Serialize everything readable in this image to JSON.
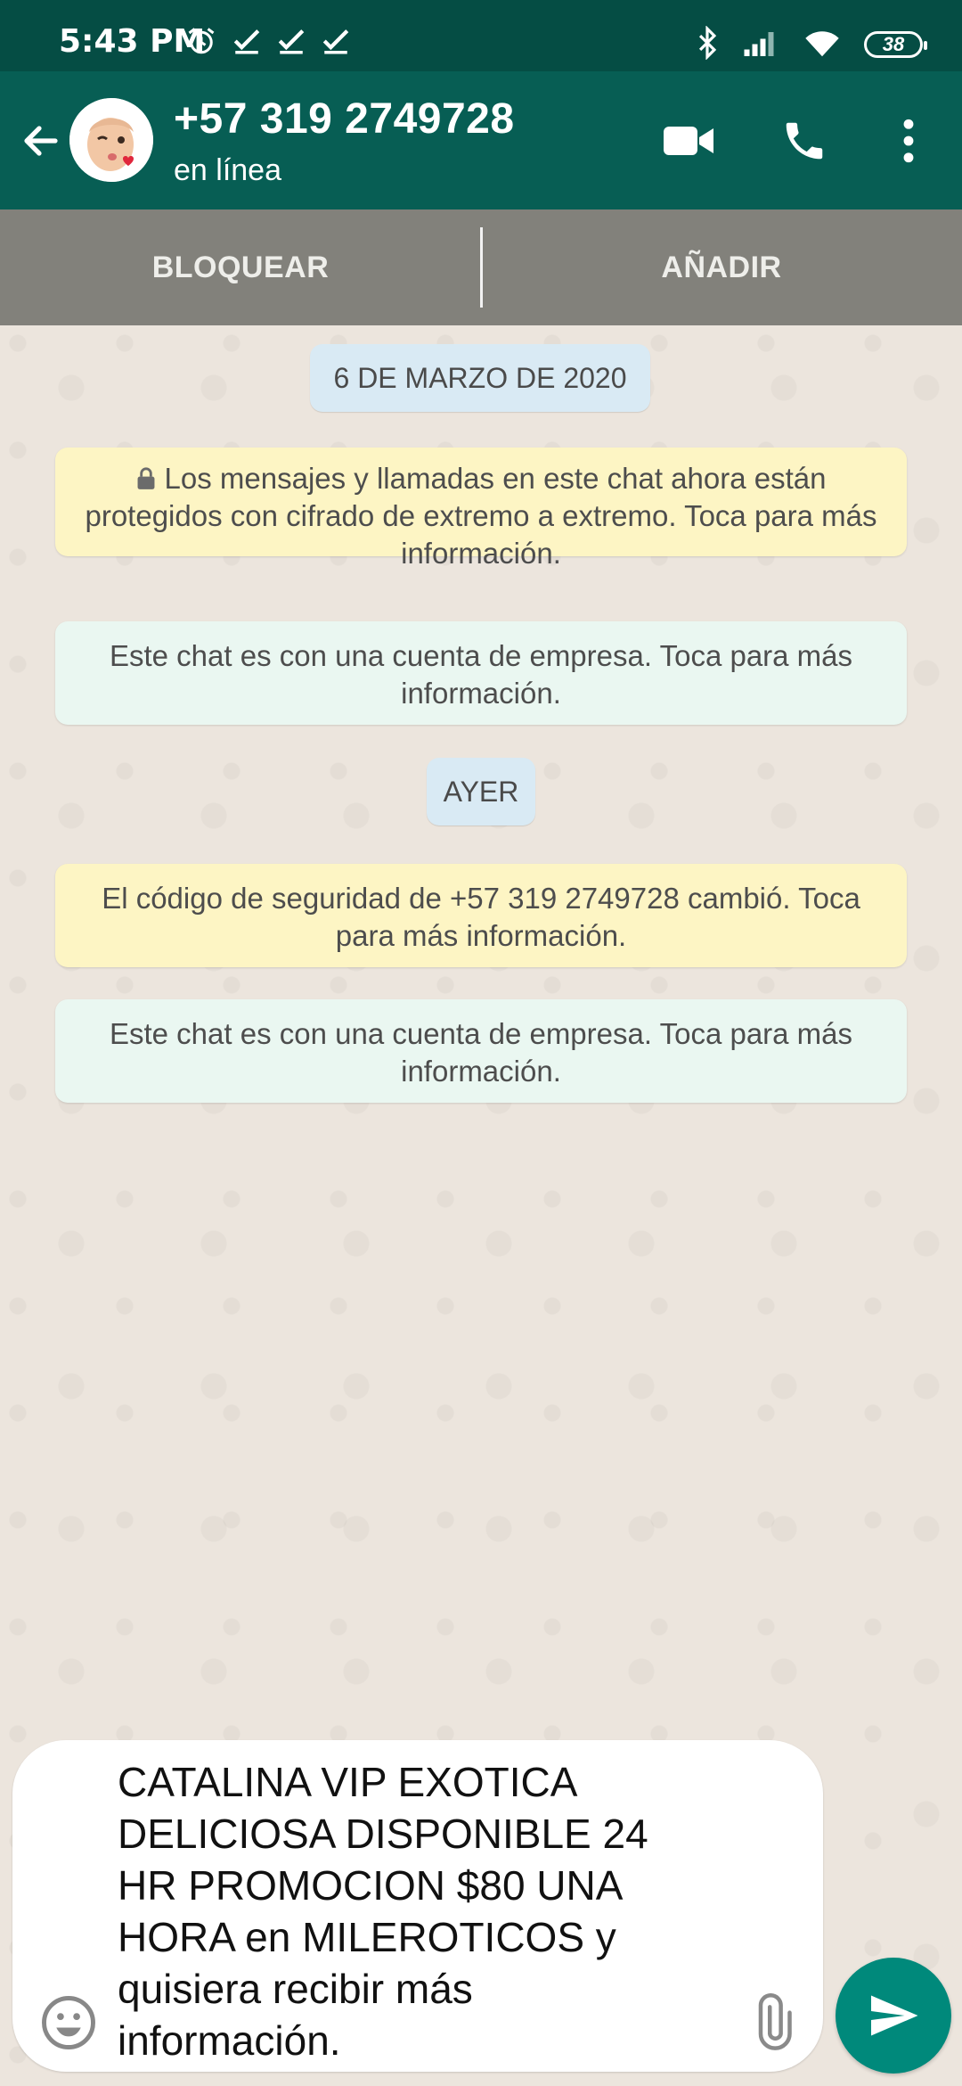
{
  "status_bar": {
    "time": "5:43 PM",
    "battery": "38",
    "icons_left": [
      "alarm-icon",
      "check-icon",
      "check-icon",
      "check-icon"
    ],
    "icons_right": [
      "bluetooth-icon",
      "signal-icon",
      "wifi-icon",
      "battery-icon"
    ]
  },
  "header": {
    "contact_name": "+57 319 2749728",
    "status": "en línea",
    "icons": [
      "back-arrow-icon",
      "video-call-icon",
      "phone-icon",
      "more-vert-icon"
    ]
  },
  "business_bar": {
    "block_label": "BLOQUEAR",
    "add_label": "AÑADIR"
  },
  "chat": {
    "date_1": "6 DE MARZO DE 2020",
    "encryption_notice": "Los mensajes y llamadas en este chat ahora están protegidos con cifrado de extremo a extremo. Toca para más información.",
    "business_notice_1": "Este chat es con una cuenta de empresa. Toca para más información.",
    "date_2": "AYER",
    "security_code_notice": "El código de seguridad de +57 319 2749728 cambió. Toca para más información.",
    "business_notice_2": "Este chat es con una cuenta de empresa. Toca para más información."
  },
  "composer": {
    "text": "CATALINA VIP EXOTICA DELICIOSA DISPONIBLE 24 HR PROMOCION $80 UNA HORA en MILEROTICOS y quisiera recibir más información.",
    "icons": [
      "emoji-icon",
      "attach-icon",
      "send-icon"
    ]
  },
  "colors": {
    "status_bar": "#054d44",
    "header": "#075e54",
    "send_button": "#00897b",
    "notice_yellow": "#fdf5c4",
    "notice_green": "#eaf7f1",
    "date_chip": "#d9eaf4"
  }
}
